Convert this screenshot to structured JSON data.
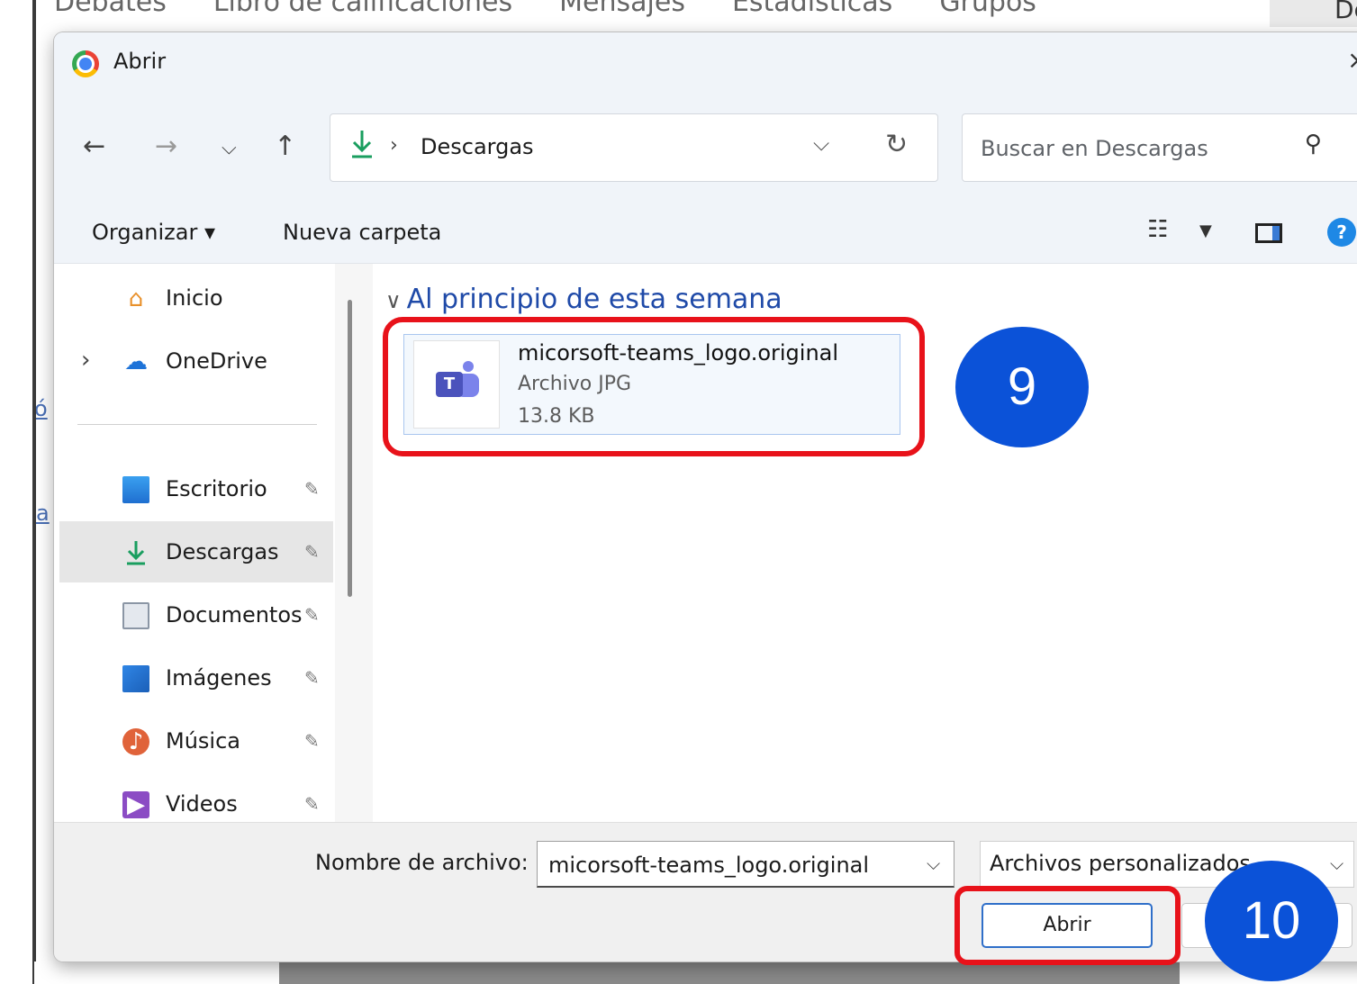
{
  "background_page": {
    "nav_items": [
      "Debates",
      "Libro de calificaciones",
      "Mensajes",
      "Estadísticas",
      "Grupos"
    ],
    "frag_right": "De",
    "frag_link_1": "ó",
    "frag_link_2": "a"
  },
  "dialog": {
    "title": "Abrir",
    "close_glyph": "×",
    "nav": {
      "back": "←",
      "forward": "→",
      "recent": "⌵",
      "up": "↑"
    },
    "address": {
      "separator": "›",
      "path": "Descargas",
      "chevron": "⌵",
      "refresh": "↻"
    },
    "search": {
      "placeholder": "Buscar en Descargas",
      "icon": "⚲"
    },
    "toolbar": {
      "organize": "Organizar ▾",
      "new_folder": "Nueva carpeta",
      "view_glyph": "☷",
      "view_caret": "▼",
      "help": "?"
    },
    "sidebar": {
      "items": [
        {
          "label": "Inicio",
          "icon": "home-icon",
          "glyph": "⌂",
          "pinned": false
        },
        {
          "label": "OneDrive",
          "icon": "cloud-icon",
          "glyph": "☁",
          "pinned": false,
          "expand": "›"
        },
        {
          "label": "Escritorio",
          "icon": "desktop-icon",
          "glyph": "",
          "pinned": true
        },
        {
          "label": "Descargas",
          "icon": "download-icon",
          "glyph": "⤓",
          "pinned": true,
          "selected": true
        },
        {
          "label": "Documentos",
          "icon": "document-icon",
          "glyph": "",
          "pinned": true
        },
        {
          "label": "Imágenes",
          "icon": "image-icon",
          "glyph": "",
          "pinned": true
        },
        {
          "label": "Música",
          "icon": "music-icon",
          "glyph": "♪",
          "pinned": true
        },
        {
          "label": "Videos",
          "icon": "video-icon",
          "glyph": "▶",
          "pinned": true
        }
      ],
      "pin_glyph": "✎"
    },
    "content": {
      "group_chevron": "∨",
      "group_title": "Al principio de esta semana",
      "file": {
        "name": "micorsoft-teams_logo.original",
        "type": "Archivo JPG",
        "size": "13.8 KB",
        "thumb_letter": "T"
      }
    },
    "footer": {
      "filename_label": "Nombre de archivo:",
      "filename_value": "micorsoft-teams_logo.original",
      "filetype_value": "Archivos personalizados",
      "chevron": "⌵",
      "open_button": "Abrir"
    }
  },
  "annotations": {
    "step_9": "9",
    "step_10": "10",
    "highlight_color": "#e8121a",
    "badge_color": "#0b52d8"
  }
}
